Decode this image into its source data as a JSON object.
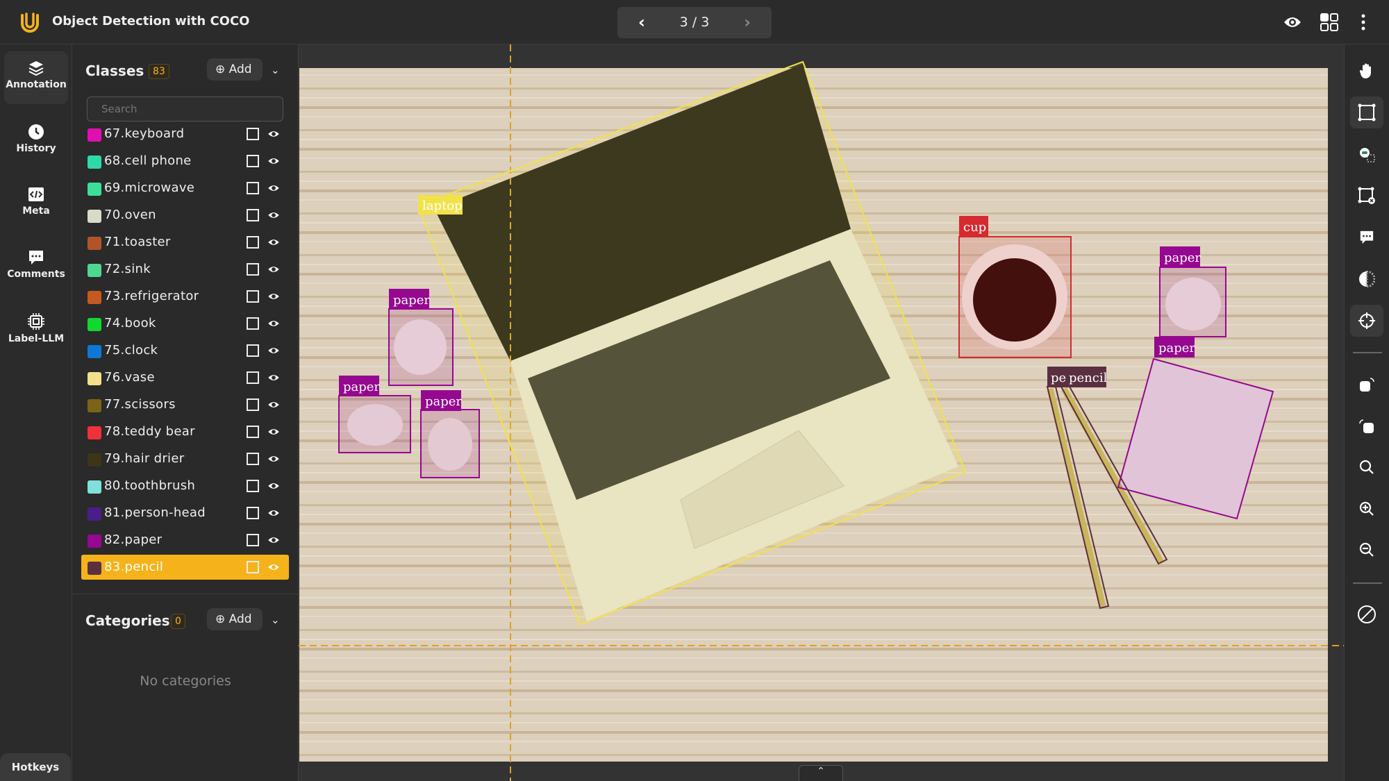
{
  "header": {
    "title": "Object Detection with COCO",
    "pager": "3 / 3",
    "prev_icon": "chevron-left-icon",
    "next_icon": "chevron-right-icon"
  },
  "leftnav": {
    "items": [
      {
        "label": "Annotation",
        "icon": "layers-icon"
      },
      {
        "label": "History",
        "icon": "clock-icon"
      },
      {
        "label": "Meta",
        "icon": "code-icon"
      },
      {
        "label": "Comments",
        "icon": "comment-icon"
      },
      {
        "label": "Label-LLM",
        "icon": "chip-icon"
      }
    ],
    "hotkeys": "Hotkeys"
  },
  "classes": {
    "title": "Classes",
    "count": "83",
    "add": "Add",
    "search_placeholder": "Search",
    "items": [
      {
        "label": "67.keyboard",
        "color": "#e010b0"
      },
      {
        "label": "68.cell phone",
        "color": "#2fd9a8"
      },
      {
        "label": "69.microwave",
        "color": "#3ddf98"
      },
      {
        "label": "70.oven",
        "color": "#d6dcc8"
      },
      {
        "label": "71.toaster",
        "color": "#b1542a"
      },
      {
        "label": "72.sink",
        "color": "#4fd790"
      },
      {
        "label": "73.refrigerator",
        "color": "#c45a20"
      },
      {
        "label": "74.book",
        "color": "#14d832"
      },
      {
        "label": "75.clock",
        "color": "#0e78d4"
      },
      {
        "label": "76.vase",
        "color": "#f3e08a"
      },
      {
        "label": "77.scissors",
        "color": "#7a6418"
      },
      {
        "label": "78.teddy bear",
        "color": "#f0303a"
      },
      {
        "label": "79.hair drier",
        "color": "#3e3518"
      },
      {
        "label": "80.toothbrush",
        "color": "#80e0dc"
      },
      {
        "label": "81.person-head",
        "color": "#4a1e8a"
      },
      {
        "label": "82.paper",
        "color": "#950890"
      },
      {
        "label": "83.pencil",
        "color": "#5a3040",
        "selected": true
      }
    ]
  },
  "categories": {
    "title": "Categories",
    "count": "0",
    "add": "Add",
    "empty": "No categories"
  },
  "annotations": [
    {
      "label": "laptop",
      "color": "#f2e24a"
    },
    {
      "label": "cup",
      "color": "#d42a30"
    },
    {
      "label": "paper",
      "color": "#950890"
    },
    {
      "label": "paper",
      "color": "#950890"
    },
    {
      "label": "paper",
      "color": "#950890"
    },
    {
      "label": "paper",
      "color": "#950890"
    },
    {
      "label": "paper",
      "color": "#950890"
    },
    {
      "label": "pe",
      "color": "#5a3040"
    },
    {
      "label": "pencil",
      "color": "#5a3040"
    }
  ],
  "accent": "#f5b21b",
  "toolbar": [
    "hand-icon",
    "bounding-box-icon",
    "auto-annotate-icon",
    "delete-box-icon",
    "comment-icon",
    "contrast-icon",
    "crosshair-icon",
    "rotate-right-icon",
    "rotate-left-icon",
    "search-icon",
    "zoom-in-icon",
    "zoom-out-icon",
    "hide-icon"
  ]
}
